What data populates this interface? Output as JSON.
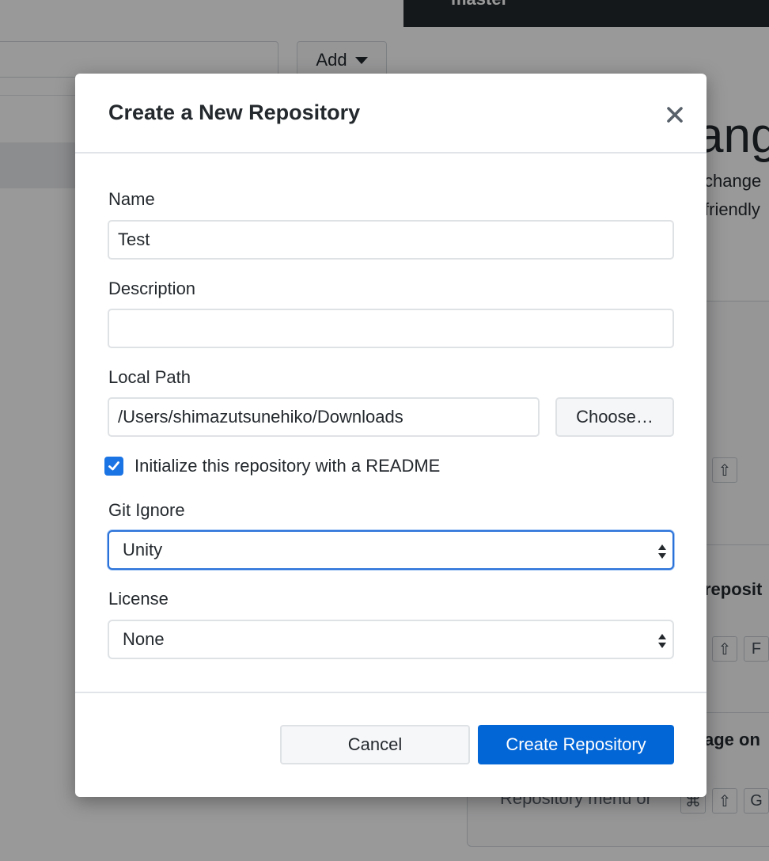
{
  "background": {
    "branch_name": "master",
    "add_button_label": "Add",
    "heading_fragment": "ang",
    "desc_line1": "change",
    "desc_line2": "friendly",
    "panel_title1": "reposit",
    "panel_title2": "age on",
    "menu_text": "Repository menu or",
    "kbd_shift": "⇧",
    "kbd_cmd": "⌘",
    "kbd_f": "F",
    "kbd_g": "G"
  },
  "dialog": {
    "title": "Create a New Repository",
    "name_label": "Name",
    "name_value": "Test",
    "description_label": "Description",
    "description_value": "",
    "local_path_label": "Local Path",
    "local_path_value": "/Users/shimazutsunehiko/Downloads",
    "choose_button": "Choose…",
    "readme_checkbox_label": "Initialize this repository with a README",
    "readme_checked": true,
    "git_ignore_label": "Git Ignore",
    "git_ignore_value": "Unity",
    "license_label": "License",
    "license_value": "None",
    "cancel_button": "Cancel",
    "create_button": "Create Repository"
  },
  "colors": {
    "primary": "#0366d6",
    "checkbox": "#1b74e4",
    "focus_border": "#2a72d9"
  }
}
